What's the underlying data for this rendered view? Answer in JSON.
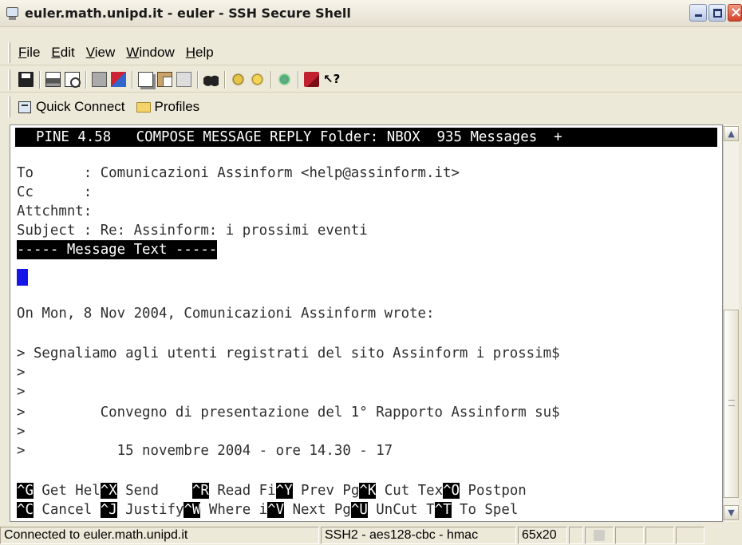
{
  "window": {
    "title": "euler.math.unipd.it - euler - SSH Secure Shell"
  },
  "menu": {
    "items": [
      {
        "label": "File",
        "accel": "F",
        "rest": "ile"
      },
      {
        "label": "Edit",
        "accel": "E",
        "rest": "dit"
      },
      {
        "label": "View",
        "accel": "V",
        "rest": "iew"
      },
      {
        "label": "Window",
        "accel": "W",
        "rest": "indow"
      },
      {
        "label": "Help",
        "accel": "H",
        "rest": "elp"
      }
    ]
  },
  "toolbar": {
    "icons": [
      "save-icon",
      "print-icon",
      "print-preview-icon",
      "new-terminal-icon",
      "new-file-transfer-icon",
      "copy-icon",
      "paste-icon",
      "paste-special-icon",
      "find-icon",
      "key-icon",
      "host-key-icon",
      "settings-icon",
      "book-icon",
      "context-help-icon"
    ]
  },
  "quickbar": {
    "quick_connect": "Quick Connect",
    "profiles": "Profiles"
  },
  "terminal": {
    "header": "PINE 4.58   COMPOSE MESSAGE REPLY Folder: NBOX  935 Messages  +",
    "to_line": "To      : Comunicazioni Assinform <help@assinform.it>",
    "cc_line": "Cc      :",
    "attch_line": "Attchmnt:",
    "subject_line": "Subject : Re: Assinform: i prossimi eventi",
    "message_text": "----- Message Text -----",
    "wrote_line": "On Mon, 8 Nov 2004, Comunicazioni Assinform wrote:",
    "quote1": "> Segnaliamo agli utenti registrati del sito Assinform i prossim$",
    "quote2": ">",
    "quote3": ">",
    "quote4": ">         Convegno di presentazione del 1° Rapporto Assinform su$",
    "quote5": ">",
    "quote6": ">           15 novembre 2004 - ore 14.30 - 17",
    "keys_row1": [
      {
        "key": "^G",
        "label": " Get Hel"
      },
      {
        "key": "^X",
        "label": " Send    "
      },
      {
        "key": "^R",
        "label": " Read Fi"
      },
      {
        "key": "^Y",
        "label": " Prev Pg"
      },
      {
        "key": "^K",
        "label": " Cut Tex"
      },
      {
        "key": "^O",
        "label": " Postpon"
      }
    ],
    "keys_row2": [
      {
        "key": "^C",
        "label": " Cancel "
      },
      {
        "key": "^J",
        "label": " Justify"
      },
      {
        "key": "^W",
        "label": " Where i"
      },
      {
        "key": "^V",
        "label": " Next Pg"
      },
      {
        "key": "^U",
        "label": " UnCut T"
      },
      {
        "key": "^T",
        "label": " To Spel"
      }
    ]
  },
  "status": {
    "connection": "Connected to euler.math.unipd.it",
    "cipher": "SSH2 - aes128-cbc - hmac",
    "size": "65x20"
  },
  "colors": {
    "cursor": "#1515e8",
    "terminal_bg": "#ffffff",
    "chrome_bg": "#ece9d8"
  }
}
